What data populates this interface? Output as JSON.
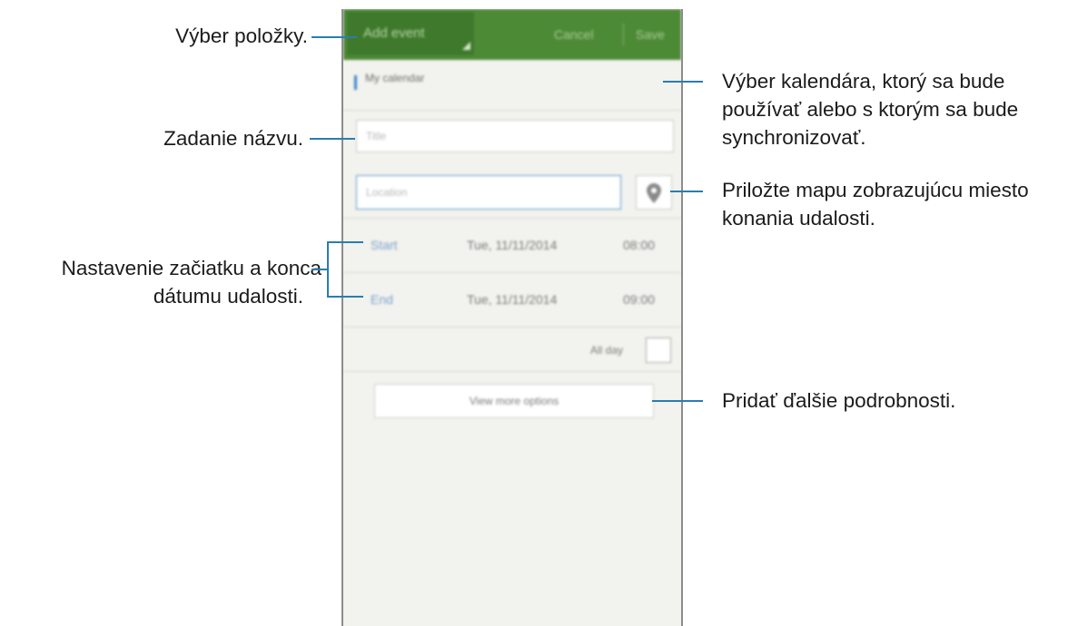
{
  "action_bar": {
    "title": "Add event",
    "cancel": "Cancel",
    "save": "Save"
  },
  "calendar": {
    "label": "My calendar"
  },
  "fields": {
    "title_placeholder": "Title",
    "location_placeholder": "Location",
    "map_icon": "map-pin-icon"
  },
  "schedule": {
    "start": {
      "label": "Start",
      "date": "Tue, 11/11/2014",
      "time": "08:00"
    },
    "end": {
      "label": "End",
      "date": "Tue, 11/11/2014",
      "time": "09:00"
    }
  },
  "all_day": {
    "label": "All day",
    "checked": false
  },
  "more_options": {
    "label": "View more options"
  },
  "annotations": {
    "select_item": "Výber položky.",
    "enter_title": "Zadanie názvu.",
    "set_dates_line1": "Nastavenie začiatku a konca",
    "set_dates_line2": "dátumu udalosti.",
    "calendar_line1": "Výber kalendára, ktorý sa bude",
    "calendar_line2": "používať alebo s ktorým sa bude",
    "calendar_line3": "synchronizovať.",
    "map_line1": "Priložte mapu zobrazujúcu miesto",
    "map_line2": "konania udalosti.",
    "more_details": "Pridať ďalšie podrobnosti."
  },
  "colors": {
    "action_bar": "#4d8a36",
    "accent_line": "#2a7db0",
    "calendar_marker": "#3a86c8"
  }
}
